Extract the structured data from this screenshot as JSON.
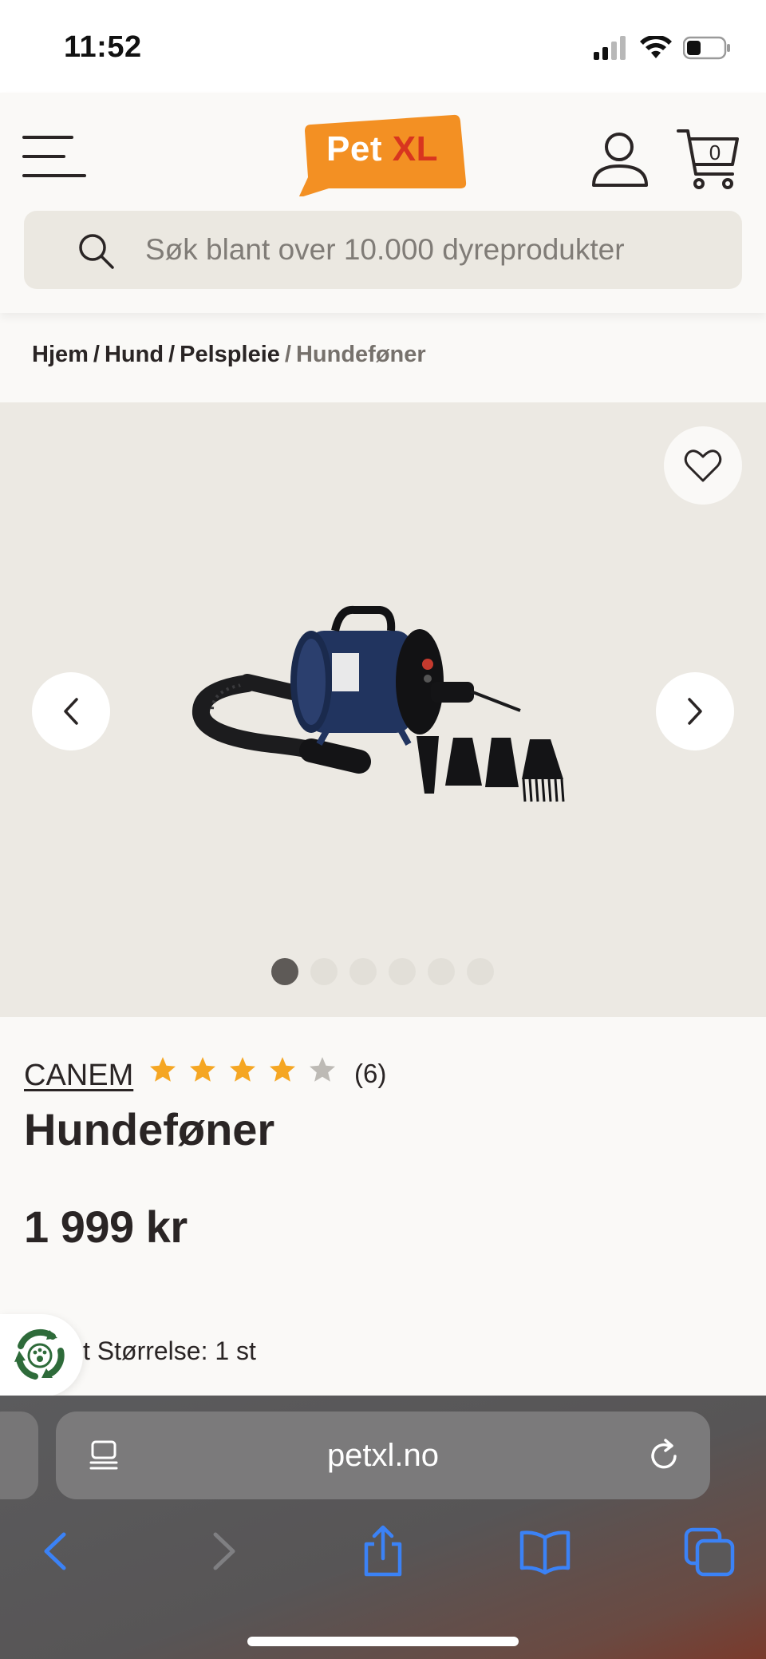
{
  "status_bar": {
    "time": "11:52",
    "icons": [
      "signal-icon",
      "wifi-icon",
      "battery-icon"
    ]
  },
  "header": {
    "logo": {
      "part1": "Pet",
      "part2": "XL",
      "brand_color": "#f39023",
      "accent_color": "#d8351f"
    },
    "cart_count": "0",
    "search_placeholder": "Søk blant over 10.000 dyreprodukter"
  },
  "breadcrumb": {
    "items": [
      "Hjem",
      "Hund",
      "Pelspleie"
    ],
    "current": "Hundeføner"
  },
  "gallery": {
    "dot_count": 6,
    "active_index": 0
  },
  "product": {
    "brand": "CANEM",
    "rating": 4,
    "rating_max": 5,
    "review_count": "(6)",
    "title": "Hundeføner",
    "price": "1 999 kr",
    "size_label": "t Størrelse: 1 st"
  },
  "browser": {
    "url": "petxl.no",
    "toolbar": [
      "back-icon",
      "forward-icon",
      "share-icon",
      "bookmarks-icon",
      "tabs-icon"
    ],
    "accent_color": "#3b82f6"
  },
  "colors": {
    "background": "#faf9f7",
    "gallery_bg": "#ece9e3",
    "star": "#f5a623",
    "star_empty": "#bdbab5",
    "text": "#2a2525"
  }
}
